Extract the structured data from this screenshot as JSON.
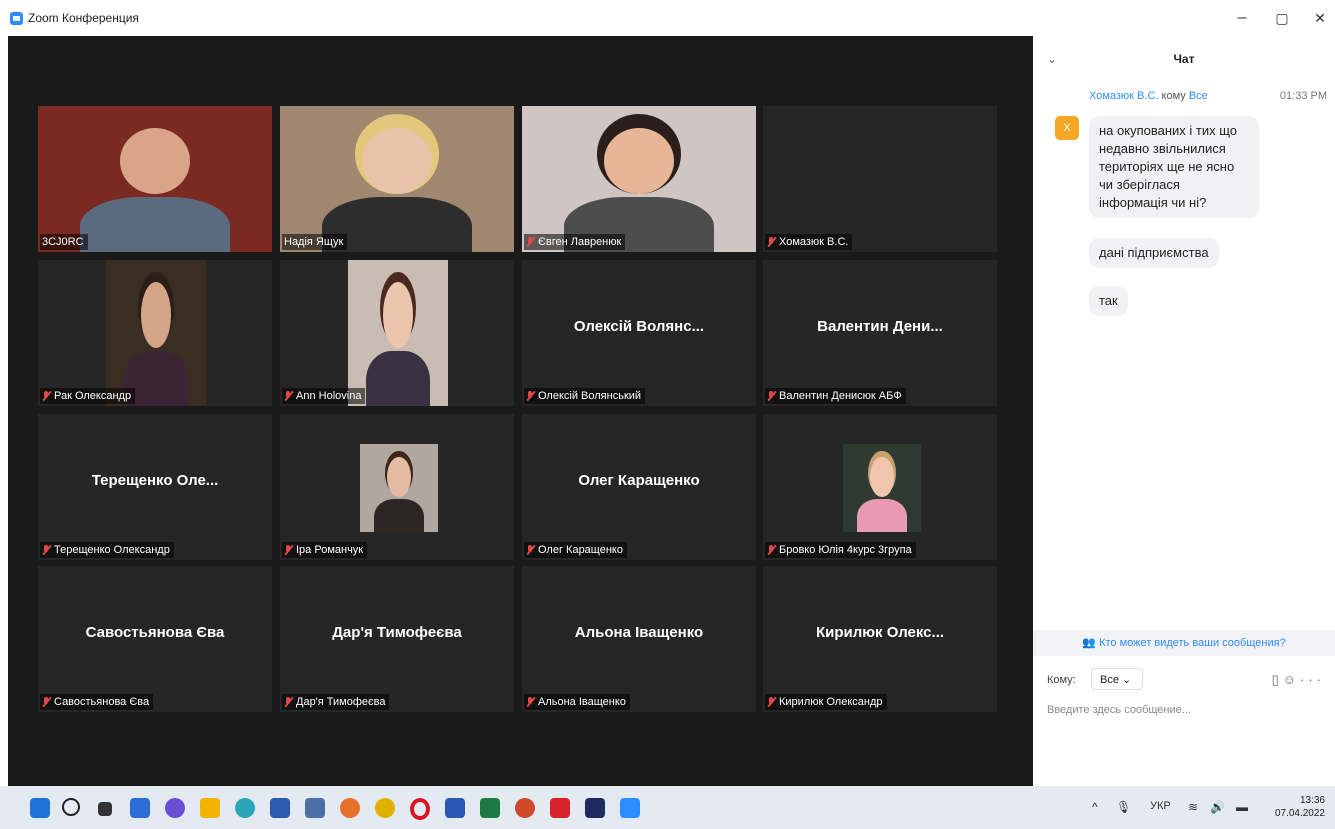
{
  "window": {
    "title": "Zoom Конференция",
    "minimize": "–",
    "restore": "▢",
    "close": "✕"
  },
  "tiles": [
    {
      "row": 0,
      "col": 0,
      "label": "3CJ0RC",
      "muted": false,
      "video": true,
      "active": true
    },
    {
      "row": 0,
      "col": 1,
      "label": "Надія Ящук",
      "muted": false,
      "video": true
    },
    {
      "row": 0,
      "col": 2,
      "label": "Євген Лавренюк",
      "muted": true,
      "video": true
    },
    {
      "row": 0,
      "col": 3,
      "label": "Хомазюк В.С.",
      "muted": true,
      "video": false,
      "big": ""
    },
    {
      "row": 1,
      "col": 0,
      "label": "Рак Олександр",
      "muted": true,
      "video": true
    },
    {
      "row": 1,
      "col": 1,
      "label": "Ann Holovina",
      "muted": true,
      "video": true
    },
    {
      "row": 1,
      "col": 2,
      "label": "Олексій Волянський",
      "muted": true,
      "video": false,
      "big": "Олексій Волянс..."
    },
    {
      "row": 1,
      "col": 3,
      "label": "Валентин Денисюк АБФ",
      "muted": true,
      "video": false,
      "big": "Валентин Дени..."
    },
    {
      "row": 2,
      "col": 0,
      "label": "Терещенко Олександр",
      "muted": true,
      "video": false,
      "big": "Терещенко Оле..."
    },
    {
      "row": 2,
      "col": 1,
      "label": "Іра Романчук",
      "muted": true,
      "video": true
    },
    {
      "row": 2,
      "col": 2,
      "label": "Олег Каращенко",
      "muted": true,
      "video": false,
      "big": "Олег Каращенко"
    },
    {
      "row": 2,
      "col": 3,
      "label": "Бровко Юлія 4курс 3група",
      "muted": true,
      "video": true
    },
    {
      "row": 3,
      "col": 0,
      "label": "Савостьянова Єва",
      "muted": true,
      "video": false,
      "big": "Савостьянова Єва"
    },
    {
      "row": 3,
      "col": 1,
      "label": "Дар'я Тимофеєва",
      "muted": true,
      "video": false,
      "big": "Дар'я Тимофеєва"
    },
    {
      "row": 3,
      "col": 2,
      "label": "Альона Іващенко",
      "muted": true,
      "video": false,
      "big": "Альона Іващенко"
    },
    {
      "row": 3,
      "col": 3,
      "label": "Кирилюк Олександр",
      "muted": true,
      "video": false,
      "big": "Кирилюк Олекс..."
    }
  ],
  "chat": {
    "title": "Чат",
    "sender": "Хомазюк В.С.",
    "to_word": "кому",
    "to": "Все",
    "time": "01:33 PM",
    "avatar_letter": "Х",
    "messages": [
      "на окупованих і тих що недавно звільнилися територіях ще не ясно чи зберіглася інформація чи ні?",
      "дані підприємства",
      "так"
    ],
    "who_can_see": "Кто может видеть ваши сообщения?",
    "to_label": "Кому:",
    "to_select": "Все",
    "input_placeholder": "Введите здесь сообщение..."
  },
  "taskbar": {
    "tray_lang": "УКР",
    "time": "13:36",
    "date": "07.04.2022"
  }
}
